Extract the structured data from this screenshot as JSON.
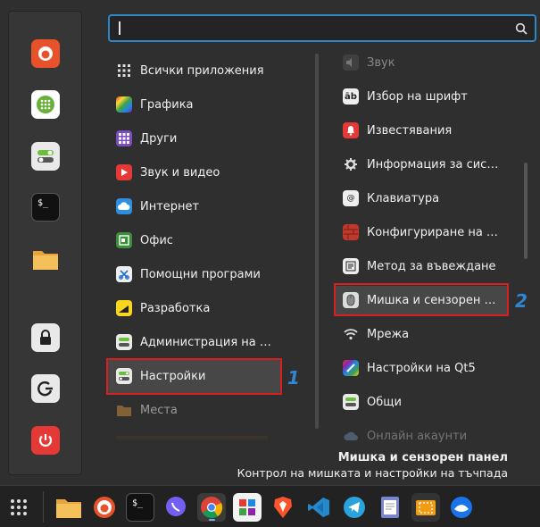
{
  "search": {
    "value": "",
    "placeholder": ""
  },
  "categories": [
    {
      "label": "Всички приложения",
      "icon": "grid-icon"
    },
    {
      "label": "Графика",
      "icon": "graphics-icon"
    },
    {
      "label": "Други",
      "icon": "other-icon"
    },
    {
      "label": "Звук и видео",
      "icon": "multimedia-icon"
    },
    {
      "label": "Интернет",
      "icon": "internet-icon"
    },
    {
      "label": "Офис",
      "icon": "office-icon"
    },
    {
      "label": "Помощни програми",
      "icon": "accessories-icon"
    },
    {
      "label": "Разработка",
      "icon": "development-icon"
    },
    {
      "label": "Администрация на системата",
      "icon": "administration-icon"
    },
    {
      "label": "Настройки",
      "icon": "settings-icon"
    },
    {
      "label": "Места",
      "icon": "folder-icon"
    }
  ],
  "apps": [
    {
      "label": "Звук",
      "icon": "sound-icon"
    },
    {
      "label": "Избор на шрифт",
      "icon": "font-icon"
    },
    {
      "label": "Известявания",
      "icon": "notification-bell-icon"
    },
    {
      "label": "Информация за системата",
      "icon": "system-info-icon"
    },
    {
      "label": "Клавиатура",
      "icon": "keyboard-icon"
    },
    {
      "label": "Конфигуриране на защитната стена",
      "icon": "firewall-icon"
    },
    {
      "label": "Метод за въвеждане",
      "icon": "input-method-icon"
    },
    {
      "label": "Мишка и сензорен панел",
      "icon": "mouse-icon"
    },
    {
      "label": "Мрежа",
      "icon": "network-wifi-icon"
    },
    {
      "label": "Настройки на Qt5",
      "icon": "qt5-icon"
    },
    {
      "label": "Общи",
      "icon": "general-toggle-icon"
    },
    {
      "label": "Онлайн акаунти",
      "icon": "cloud-icon"
    }
  ],
  "description": {
    "title": "Мишка и сензорен панел",
    "subtitle": "Контрол на мишката и настройки на тъчпада"
  },
  "annotations": {
    "first": "1",
    "second": "2"
  },
  "colors": {
    "accent": "#2f87c5",
    "highlight": "#d81f1f",
    "annotation_number": "#2d86d6"
  }
}
